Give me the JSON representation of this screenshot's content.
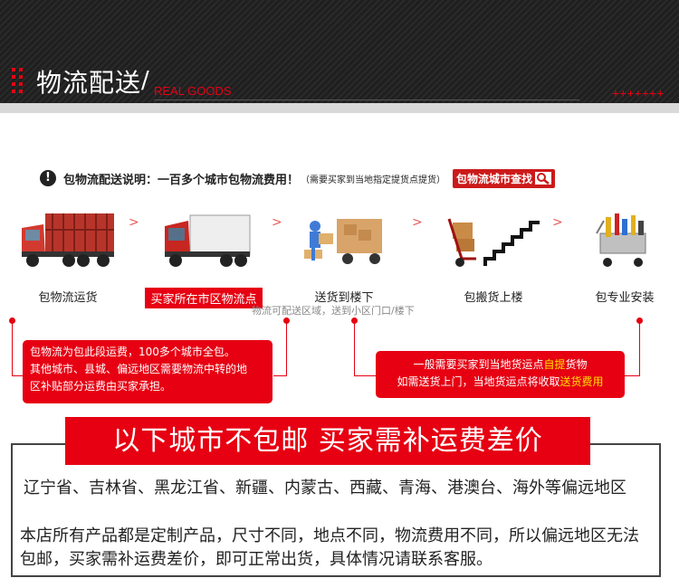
{
  "header": {
    "title": "物流配送",
    "subtitle": "REAL GOODS",
    "plus_marks": "+++++++"
  },
  "notice": {
    "icon": "exclamation-icon",
    "bold_text": "包物流配送说明：一百多个城市包物流费用！",
    "small_text": "（需要买家到当地指定提货点提货）",
    "button_label": "包物流城市查找"
  },
  "steps": [
    {
      "label": "包物流运货",
      "icon": "red-cargo-truck-icon"
    },
    {
      "label": "买家所在市区物流点",
      "icon": "red-box-truck-icon"
    },
    {
      "label": "送货到楼下",
      "icon": "delivery-truck-loading-icon"
    },
    {
      "label": "包搬货上楼",
      "icon": "hand-cart-stairs-icon"
    },
    {
      "label": "包专业安装",
      "icon": "tool-cart-icon"
    }
  ],
  "sublabel": "物流可配送区域，送到小区门口/楼下",
  "left_box": {
    "lines": [
      "包物流为包此段运费，100多个城市全包。",
      "其他城市、县城、偏远地区需要物流中转的地",
      "区补贴部分运费由买家承担。"
    ]
  },
  "right_box": {
    "line1_prefix": "一般需要买家到当地货运点",
    "line1_highlight": "自提",
    "line1_suffix": "货物",
    "line2_prefix": "如需送货上门，当地货运点将收取",
    "line2_highlight": "送货费用"
  },
  "banner": {
    "text": "以下城市不包邮   买家需补运费差价"
  },
  "provinces_text": "辽宁省、吉林省、黑龙江省、新疆、内蒙古、西藏、青海、港澳台、海外等偏远地区",
  "policy_text": "本店所有产品都是定制产品，尺寸不同，地点不同，物流费用不同，所以偏远地区无法包邮，买家需补运费差价，即可正常出货，具体情况请联系客服。",
  "colors": {
    "accent_red": "#e60012",
    "highlight_yellow": "#ffe100",
    "header_dark": "#1f1f1f"
  }
}
